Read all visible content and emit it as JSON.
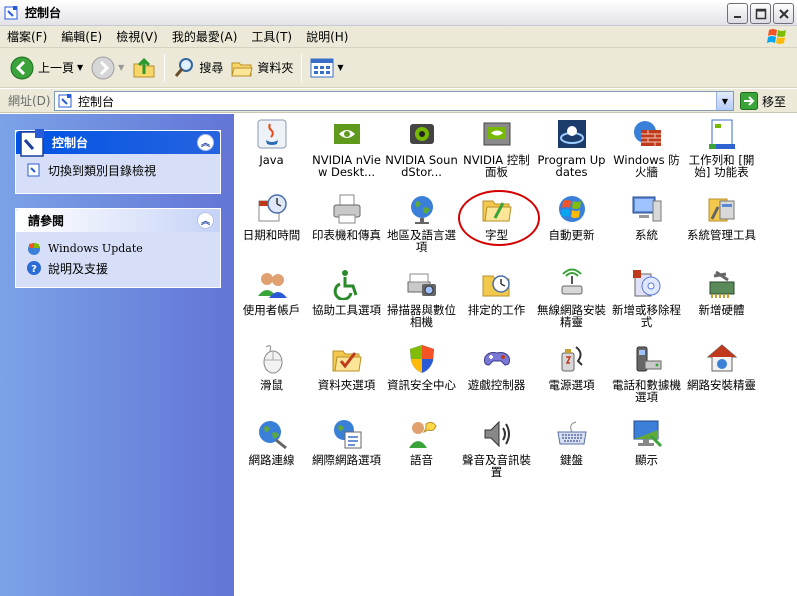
{
  "window": {
    "title": "控制台"
  },
  "menu": [
    "檔案(F)",
    "編輯(E)",
    "檢視(V)",
    "我的最愛(A)",
    "工具(T)",
    "說明(H)"
  ],
  "toolbar": {
    "back_label": "上一頁",
    "search_label": "搜尋",
    "folders_label": "資料夾"
  },
  "address": {
    "label": "網址(D)",
    "value": "控制台",
    "go_label": "移至"
  },
  "sidebar": {
    "panel1": {
      "title": "控制台",
      "task": "切換到類別目錄檢視"
    },
    "panel2": {
      "title": "請參閱",
      "links": [
        "Windows Update",
        "說明及支援"
      ]
    }
  },
  "items": [
    {
      "label": "Java",
      "icon": "java-icon"
    },
    {
      "label": "NVIDIA nView Deskt...",
      "icon": "nvidia-nview-icon"
    },
    {
      "label": "NVIDIA SoundStor...",
      "icon": "nvidia-soundstorm-icon"
    },
    {
      "label": "NVIDIA 控制面板",
      "icon": "nvidia-control-panel-icon"
    },
    {
      "label": "Program Updates",
      "icon": "program-updates-icon"
    },
    {
      "label": "Windows 防火牆",
      "icon": "firewall-icon"
    },
    {
      "label": "工作列和 [開始] 功能表",
      "icon": "taskbar-icon"
    },
    {
      "label": "日期和時間",
      "icon": "date-time-icon"
    },
    {
      "label": "印表機和傳真",
      "icon": "printer-icon"
    },
    {
      "label": "地區及語言選項",
      "icon": "globe-icon"
    },
    {
      "label": "字型",
      "icon": "fonts-folder-icon"
    },
    {
      "label": "自動更新",
      "icon": "auto-update-icon"
    },
    {
      "label": "系統",
      "icon": "system-icon"
    },
    {
      "label": "系統管理工具",
      "icon": "admin-tools-icon"
    },
    {
      "label": "使用者帳戶",
      "icon": "user-accounts-icon"
    },
    {
      "label": "協助工具選項",
      "icon": "accessibility-icon"
    },
    {
      "label": "掃描器與數位相機",
      "icon": "scanner-icon"
    },
    {
      "label": "排定的工作",
      "icon": "scheduled-tasks-icon"
    },
    {
      "label": "無線網路安裝精靈",
      "icon": "wireless-icon"
    },
    {
      "label": "新增或移除程式",
      "icon": "add-remove-icon"
    },
    {
      "label": "新增硬體",
      "icon": "add-hardware-icon"
    },
    {
      "label": "滑鼠",
      "icon": "mouse-icon"
    },
    {
      "label": "資料夾選項",
      "icon": "folder-options-icon"
    },
    {
      "label": "資訊安全中心",
      "icon": "security-center-icon"
    },
    {
      "label": "遊戲控制器",
      "icon": "game-controller-icon"
    },
    {
      "label": "電源選項",
      "icon": "power-icon"
    },
    {
      "label": "電話和數據機選項",
      "icon": "phone-modem-icon"
    },
    {
      "label": "網路安裝精靈",
      "icon": "network-setup-icon"
    },
    {
      "label": "網路連線",
      "icon": "network-connections-icon"
    },
    {
      "label": "網際網路選項",
      "icon": "internet-options-icon"
    },
    {
      "label": "語音",
      "icon": "speech-icon"
    },
    {
      "label": "聲音及音訊裝置",
      "icon": "sound-icon"
    },
    {
      "label": "鍵盤",
      "icon": "keyboard-icon"
    },
    {
      "label": "顯示",
      "icon": "display-icon"
    }
  ]
}
